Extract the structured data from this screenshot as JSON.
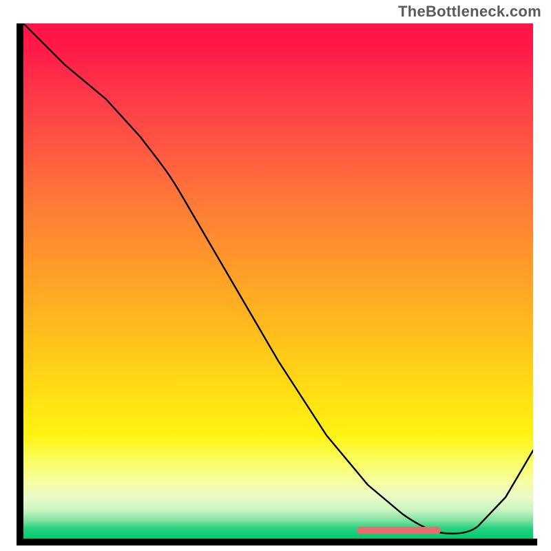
{
  "watermark": "TheBottleneck.com",
  "colors": {
    "axis": "#000000",
    "curve": "#000000",
    "marker": "#ea6a6e",
    "gradient_top": "#ff1347",
    "gradient_mid": "#ffc61a",
    "gradient_bottom": "#00c96e"
  },
  "chart_data": {
    "type": "line",
    "title": "",
    "xlabel": "",
    "ylabel": "",
    "xlim": [
      0,
      100
    ],
    "ylim": [
      0,
      100
    ],
    "x": [
      0,
      6,
      12,
      18,
      24,
      30,
      36,
      42,
      48,
      54,
      60,
      66,
      72,
      78,
      82,
      86,
      90,
      94,
      100
    ],
    "values": [
      100,
      92,
      86,
      79,
      72,
      62,
      52,
      42,
      33,
      25,
      18,
      12,
      7,
      3,
      1.5,
      1,
      3,
      8,
      18
    ],
    "marker_range_x": [
      66,
      82
    ],
    "annotations": []
  }
}
